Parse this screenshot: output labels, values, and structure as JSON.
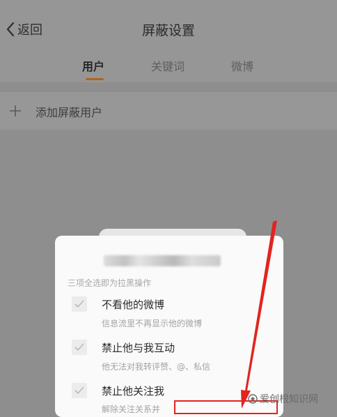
{
  "header": {
    "back_label": "返回",
    "title": "屏蔽设置",
    "tabs": [
      {
        "label": "用户",
        "active": true
      },
      {
        "label": "关键词",
        "active": false
      },
      {
        "label": "微博",
        "active": false
      }
    ]
  },
  "add_row": {
    "label": "添加屏蔽用户",
    "icon": "plus-icon"
  },
  "dialog": {
    "hint": "三项全选即为拉黑操作",
    "options": [
      {
        "title": "不看他的微博",
        "desc": "信息流里不再显示他的微博",
        "checked": true
      },
      {
        "title": "禁止他与我互动",
        "desc": "他无法对我转评赞、@、私信",
        "checked": true
      },
      {
        "title": "禁止他关注我",
        "desc": "解除关注关系并",
        "checked": true
      }
    ]
  },
  "highlight": {
    "color": "#e3231f"
  },
  "watermark": {
    "text": "爱创根知识网"
  },
  "colors": {
    "tab_accent": "#b0661a",
    "arrow": "#e3231f"
  }
}
